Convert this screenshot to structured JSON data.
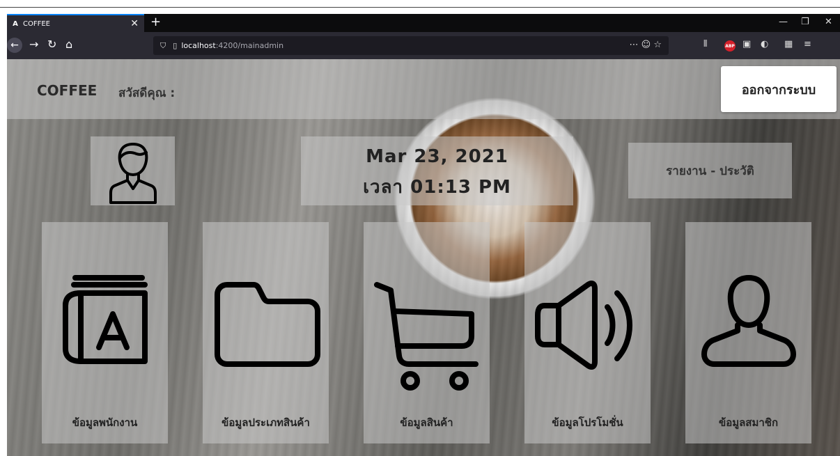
{
  "browser": {
    "tab_title": "COFFEE",
    "tab_favicon": "A",
    "url_host": "localhost",
    "url_path": ":4200/mainadmin"
  },
  "header": {
    "brand": "COFFEE",
    "greeting": "สวัสดีคุณ :",
    "logout_label": "ออกจากระบบ"
  },
  "datetime": {
    "date": "Mar 23, 2021",
    "time": "เวลา 01:13 PM"
  },
  "report_label": "รายงาน - ประวัติ",
  "menu": [
    {
      "label": "ข้อมูลพนักงาน",
      "icon": "address-book-icon"
    },
    {
      "label": "ข้อมูลประเภทสินค้า",
      "icon": "folder-icon"
    },
    {
      "label": "ข้อมูลสินค้า",
      "icon": "cart-icon"
    },
    {
      "label": "ข้อมูลโปรโมชั่น",
      "icon": "speaker-icon"
    },
    {
      "label": "ข้อมูลสมาชิก",
      "icon": "user-icon"
    }
  ]
}
